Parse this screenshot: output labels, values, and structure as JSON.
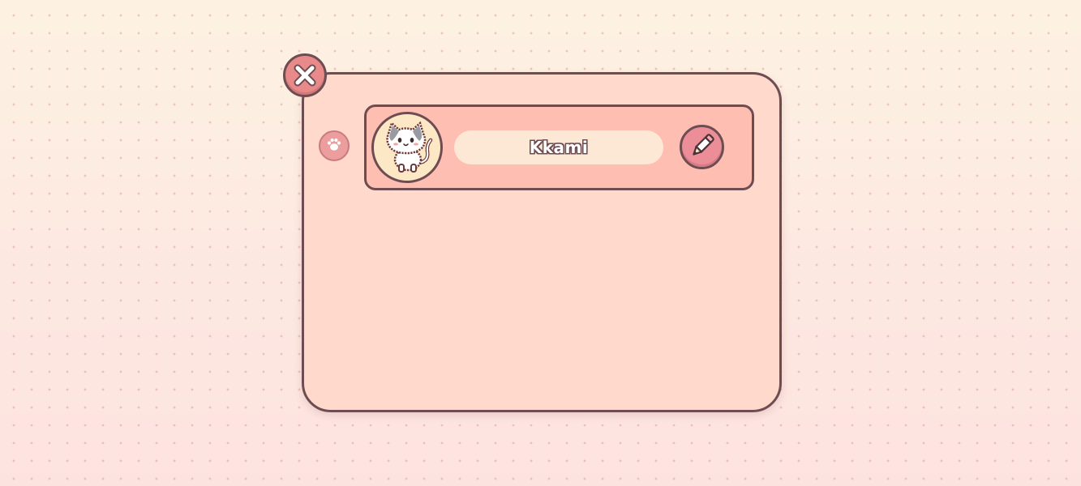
{
  "pet": {
    "name": "Kkami",
    "avatar_icon": "cat-icon"
  },
  "icons": {
    "close": "close-icon",
    "paw": "paw-icon",
    "edit": "pencil-icon"
  },
  "colors": {
    "panel_bg": "#fed9cc",
    "card_bg": "#ffbeb2",
    "outline": "#6e4d52",
    "close_button": "#e98a8a",
    "edit_button": "#ec8e98",
    "name_pill": "#fde8d6",
    "avatar_bg": "#fde8c6"
  }
}
